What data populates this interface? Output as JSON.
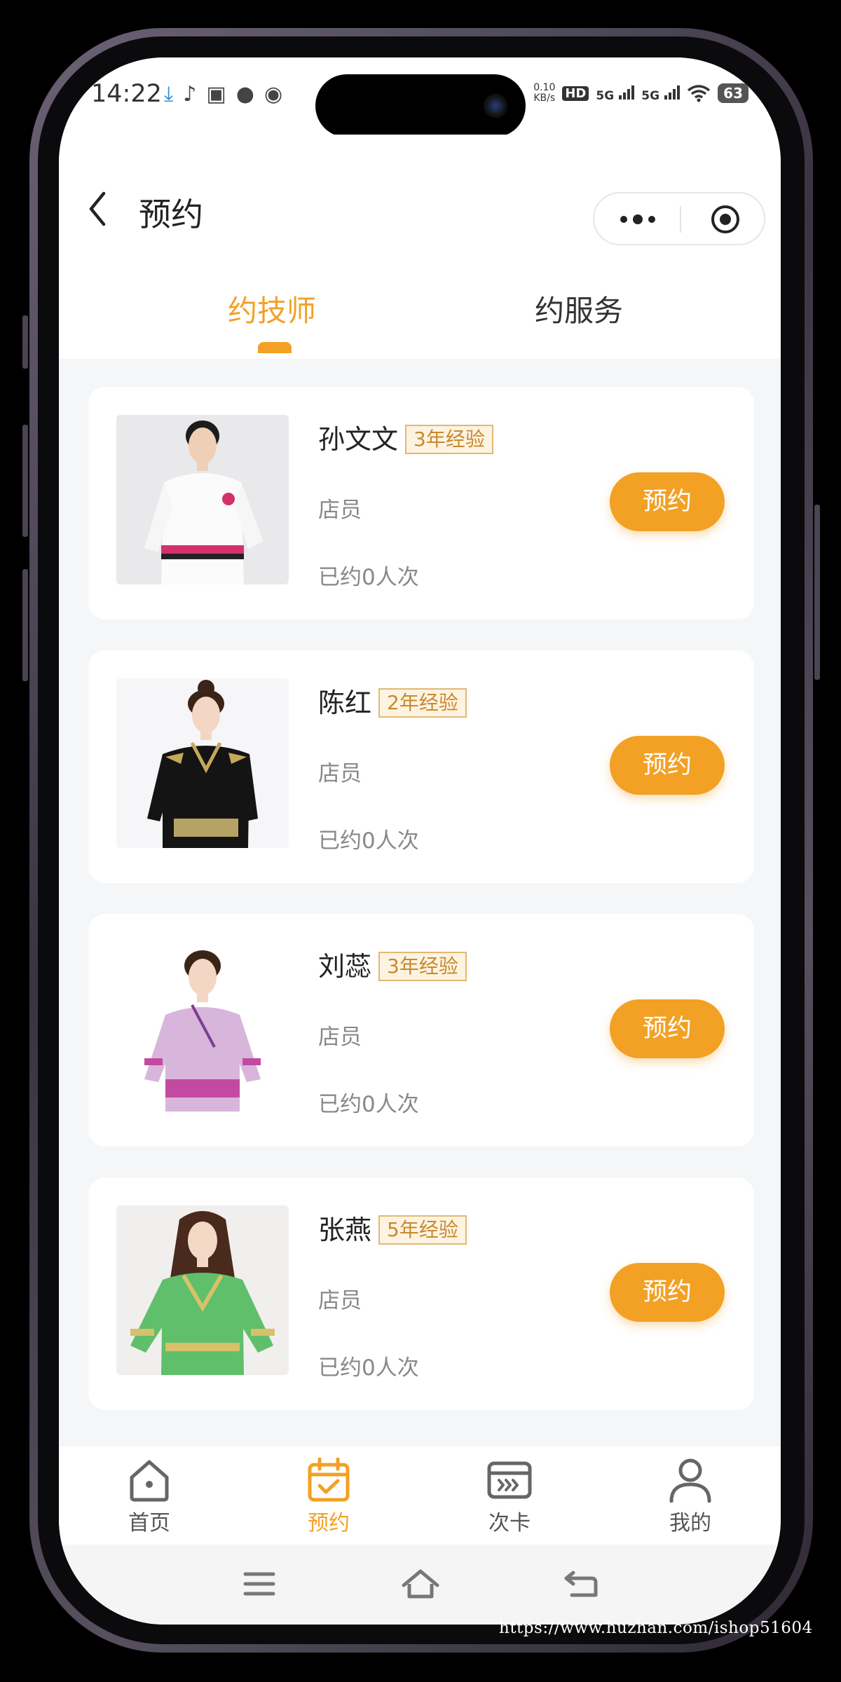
{
  "status_bar": {
    "time": "14:22",
    "net_speed_top": "0.10",
    "net_speed_bottom": "KB/s",
    "hd_label": "HD",
    "signal1": "5G",
    "signal2": "5G",
    "battery": "63"
  },
  "header": {
    "title": "预约"
  },
  "tabs": [
    {
      "label": "约技师",
      "active": true
    },
    {
      "label": "约服务",
      "active": false
    }
  ],
  "technicians": [
    {
      "name": "孙文文",
      "experience": "3年经验",
      "role": "店员",
      "booked": "已约0人次",
      "button": "预约",
      "uniform": "white"
    },
    {
      "name": "陈红",
      "experience": "2年经验",
      "role": "店员",
      "booked": "已约0人次",
      "button": "预约",
      "uniform": "black"
    },
    {
      "name": "刘蕊",
      "experience": "3年经验",
      "role": "店员",
      "booked": "已约0人次",
      "button": "预约",
      "uniform": "lilac"
    },
    {
      "name": "张燕",
      "experience": "5年经验",
      "role": "店员",
      "booked": "已约0人次",
      "button": "预约",
      "uniform": "green"
    }
  ],
  "tabbar": [
    {
      "label": "首页",
      "icon": "home-icon",
      "active": false
    },
    {
      "label": "预约",
      "icon": "calendar-check-icon",
      "active": true
    },
    {
      "label": "次卡",
      "icon": "card-icon",
      "active": false
    },
    {
      "label": "我的",
      "icon": "user-icon",
      "active": false
    }
  ],
  "watermark": "https://www.huzhan.com/ishop51604",
  "colors": {
    "accent": "#f2a125",
    "badge_border": "#e3b774",
    "muted_text": "#888888",
    "page_bg": "#f4f6f7"
  }
}
